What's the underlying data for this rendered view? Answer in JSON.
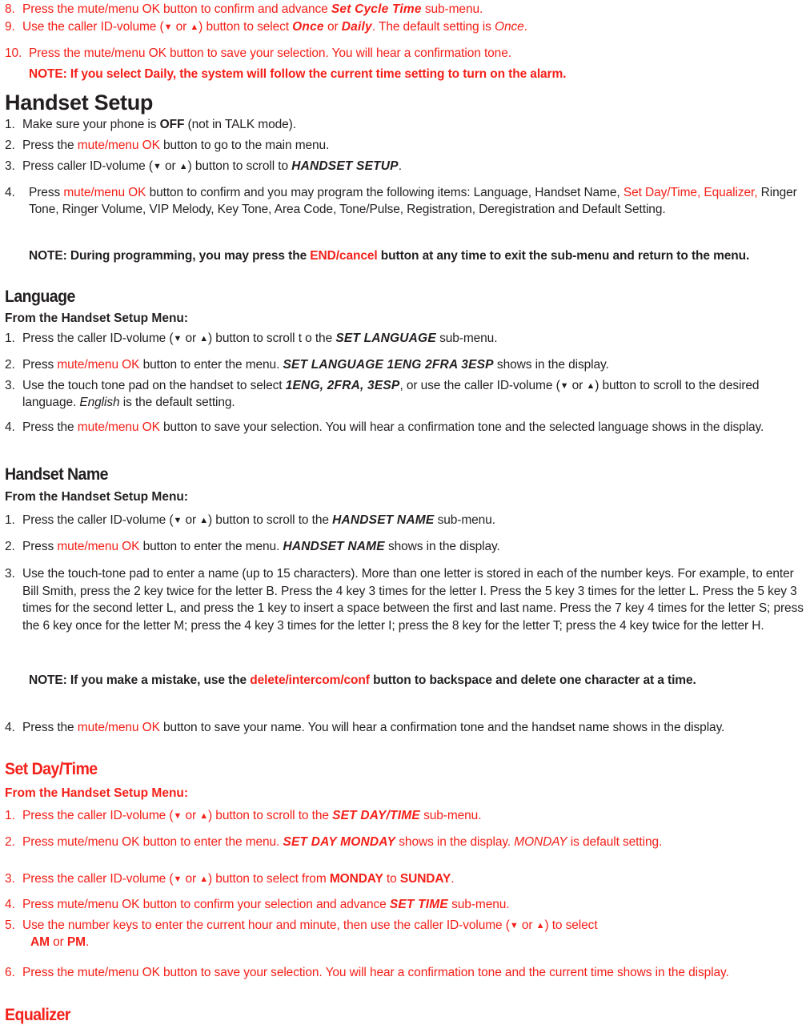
{
  "document": {
    "language": "en",
    "colors": {
      "red": "#f42019",
      "black": "#231f20"
    },
    "glyphs": {
      "down_arrow": "▼",
      "up_arrow": "▲"
    }
  },
  "alarm_section": {
    "step8": {
      "num": "8.",
      "text_a": "Press the mute/menu OK button to confirm and advance ",
      "emph": "Set Cycle Time",
      "text_b": " sub-menu."
    },
    "step9": {
      "num": "9.",
      "text_a": "Use the caller ID-volume (",
      "mid": "  or ",
      "text_b": ") button to select ",
      "emph_once": "Once",
      "text_c": " or ",
      "emph_daily": "Daily",
      "text_d": ". The default setting is ",
      "emph_default": "Once",
      "text_e": "."
    },
    "step10": {
      "num": "10.",
      "text": "Press the mute/menu OK button to save your selection. You will hear a confirmation tone."
    },
    "note": "NOTE: If you select Daily, the system will follow the current time setting to turn on the alarm."
  },
  "handset_setup": {
    "heading": "Handset Setup",
    "step1": {
      "num": "1.",
      "text_a": "Make sure your phone is ",
      "emph": "OFF",
      "text_b": " (not in TALK mode)."
    },
    "step2": {
      "num": "2.",
      "text_a": "Press the ",
      "red_run": "mute/menu OK",
      "text_b": " button to go to the main menu."
    },
    "step3": {
      "num": "3.",
      "text_a": "Press caller ID-volume (",
      "mid": "  or ",
      "text_b": ") button to scroll to ",
      "emph": "HANDSET SETUP",
      "text_c": "."
    },
    "step4": {
      "num": "4.",
      "text_a": "Press ",
      "red_run": "mute/menu OK",
      "text_b": " button to confirm and you may program the following items: Language, Handset Name,",
      "red_run2": "Set Day/Time, Equalizer,",
      "text_c": " Ringer Tone, Ringer Volume, VIP Melody, Key Tone, Area Code, Tone/Pulse, Registration, Deregistration and Default Setting."
    },
    "note": {
      "text_a": "NOTE: During programming, you may press the ",
      "red_run": "END/cancel",
      "text_b": " button at any time to exit the sub-menu and return to the menu."
    }
  },
  "language_section": {
    "heading": "Language",
    "from_line": "From the Handset Setup Menu:",
    "step1": {
      "num": "1.",
      "text_a": "Press the caller ID-volume (",
      "mid": "  or ",
      "text_b": ") button to scroll t o the ",
      "emph": "SET LANGUAGE",
      "text_c": " sub-menu."
    },
    "step2": {
      "num": "2.",
      "text_a": "Press ",
      "red_run": "mute/menu OK",
      "text_b": " button to enter the menu. ",
      "emph": "SET LANGUAGE 1ENG 2FRA 3ESP",
      "text_c": " shows in the display."
    },
    "step3": {
      "num": "3.",
      "text_a": "Use the touch tone pad on the handset to select ",
      "emph": "1ENG, 2FRA, 3ESP",
      "text_b": ", or use the caller ID-volume (",
      "mid": "  or ",
      "text_c": ") button to scroll to the desired language. ",
      "emph_default": "English",
      "text_d": " is the default setting."
    },
    "step4": {
      "num": "4.",
      "text_a": "Press the ",
      "red_run": "mute/menu OK",
      "text_b": " button to save your selection. You will hear a confirmation tone and the selected language shows in the display."
    }
  },
  "handset_name_section": {
    "heading": "Handset Name",
    "from_line": "From the Handset Setup Menu:",
    "step1": {
      "num": "1.",
      "text_a": "Press the caller ID-volume (",
      "mid": "  or ",
      "text_b": ") button to scroll to the ",
      "emph": "HANDSET NAME",
      "text_c": " sub-menu."
    },
    "step2": {
      "num": "2.",
      "text_a": "Press ",
      "red_run": "mute/menu OK",
      "text_b": " button to enter the menu. ",
      "emph": "HANDSET NAME",
      "text_c": " shows in the display."
    },
    "step3": {
      "num": "3.",
      "text": "Use the touch-tone pad to enter a name (up to 15 characters). More than one letter is stored in each of the number keys. For example, to enter Bill Smith, press the 2 key twice for the letter B. Press the 4 key 3 times for the letter I. Press the 5 key 3 times for the letter L. Press the 5 key 3 times for the second letter L, and press the 1 key to insert a space between the first and last name. Press the 7 key 4 times for the letter S; press the 6 key once for the letter M; press the 4 key 3 times for the letter I; press the 8 key for the letter T; press the 4 key twice for the letter H."
    },
    "note": {
      "text_a": "NOTE: If you make a mistake, use the ",
      "red_run": "delete/intercom/conf",
      "text_b": " button to backspace and delete one character at a time."
    },
    "step4": {
      "num": "4.",
      "text_a": "Press the ",
      "red_run": "mute/menu OK",
      "text_b": " button to save your name. You will hear a confirmation tone and the handset name shows in the display."
    }
  },
  "set_day_time_section": {
    "heading": "Set Day/Time",
    "from_line": "From the Handset Setup Menu:",
    "step1": {
      "num": "1.",
      "text_a": "Press the caller ID-volume (",
      "mid": "  or ",
      "text_b": ") button to scroll to the ",
      "emph": "SET DAY/TIME",
      "text_c": " sub-menu."
    },
    "step2": {
      "num": "2.",
      "text_a": "Press mute/menu OK button to enter the menu. ",
      "emph": "SET DAY MONDAY",
      "text_b": " shows in the display. ",
      "emph_default": "MONDAY",
      "text_c": " is default setting."
    },
    "step3": {
      "num": "3.",
      "text_a": "Press the caller ID-volume (",
      "mid": "  or ",
      "text_b": ") button to select from ",
      "emph_a": "MONDAY",
      "text_c": " to ",
      "emph_b": "SUNDAY",
      "text_d": "."
    },
    "step4": {
      "num": "4.",
      "text_a": "Press mute/menu OK button to confirm your selection and advance ",
      "emph": "SET TIME",
      "text_b": " sub-menu."
    },
    "step5": {
      "num": "5.",
      "text_a": "Use the number keys to enter the current hour and minute, then use the caller ID-volume (",
      "mid": " or ",
      "text_b": ") to select ",
      "emph_am": "AM",
      "text_c": " or ",
      "emph_pm": "PM",
      "text_d": "."
    },
    "step6": {
      "num": "6.",
      "text": "Press the mute/menu OK button to save your selection. You will hear a confirmation tone and the current time shows in the display."
    }
  },
  "equalizer_section": {
    "heading": "Equalizer"
  }
}
